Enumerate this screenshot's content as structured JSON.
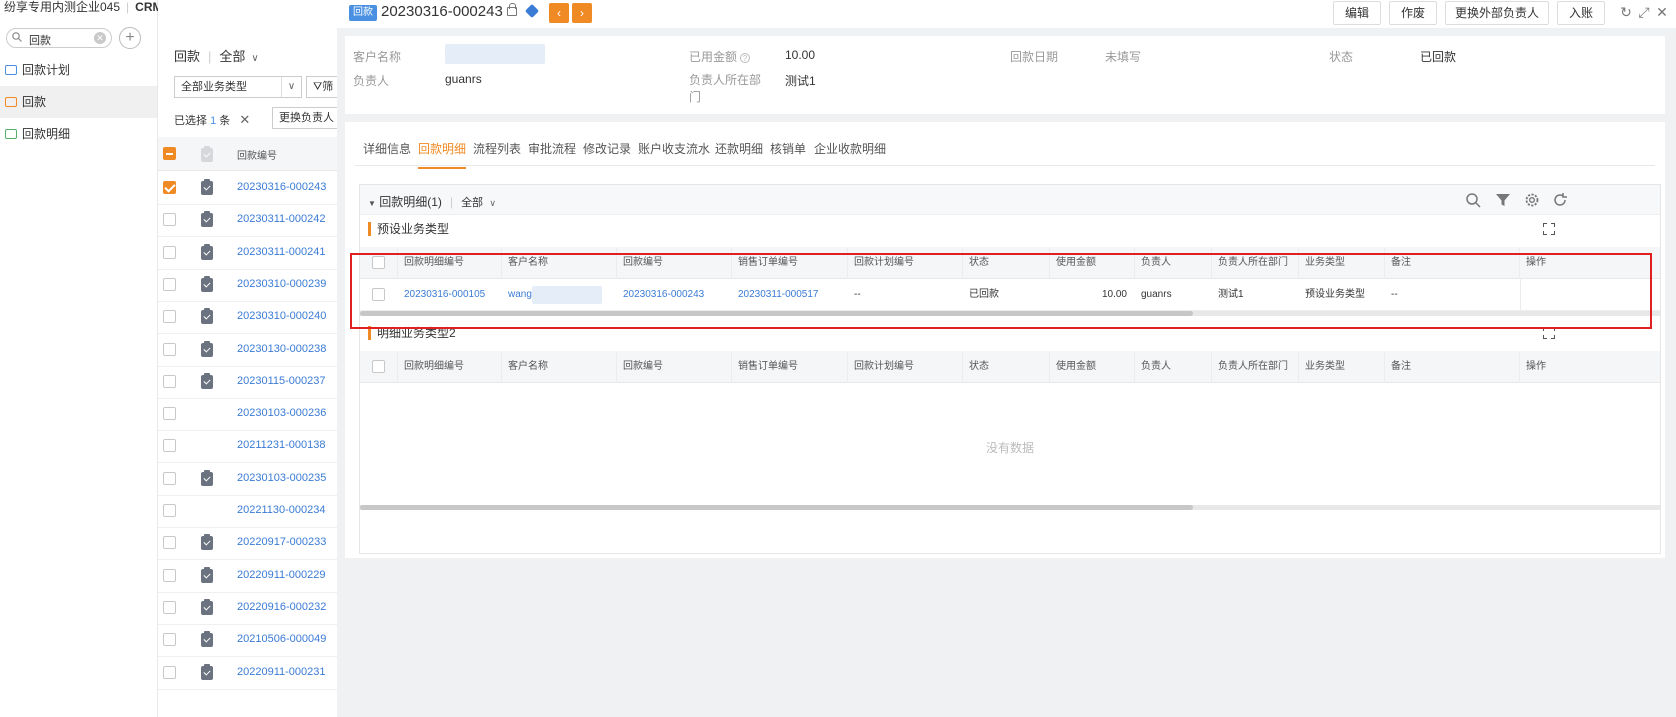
{
  "app": {
    "brand": "纷享专用内测企业045",
    "module": "CRM"
  },
  "nav": {
    "search_value": "回款",
    "items": [
      {
        "label": "回款计划"
      },
      {
        "label": "回款"
      },
      {
        "label": "回款明细"
      }
    ]
  },
  "list": {
    "object": "回款",
    "scope": "全部",
    "type_filter": "全部业务类型",
    "filter_label": "筛",
    "selected_prefix": "已选择",
    "selected_count": "1",
    "selected_suffix": "条",
    "change_owner": "更换负责人",
    "col_code": "回款编号",
    "rows": [
      {
        "code": "20230316-000243",
        "checked": true,
        "icon": true
      },
      {
        "code": "20230311-000242",
        "checked": false,
        "icon": true
      },
      {
        "code": "20230311-000241",
        "checked": false,
        "icon": true
      },
      {
        "code": "20230310-000239",
        "checked": false,
        "icon": true
      },
      {
        "code": "20230310-000240",
        "checked": false,
        "icon": true
      },
      {
        "code": "20230130-000238",
        "checked": false,
        "icon": true
      },
      {
        "code": "20230115-000237",
        "checked": false,
        "icon": true
      },
      {
        "code": "20230103-000236",
        "checked": false,
        "icon": false
      },
      {
        "code": "20211231-000138",
        "checked": false,
        "icon": false
      },
      {
        "code": "20230103-000235",
        "checked": false,
        "icon": true
      },
      {
        "code": "20221130-000234",
        "checked": false,
        "icon": false
      },
      {
        "code": "20220917-000233",
        "checked": false,
        "icon": true
      },
      {
        "code": "20220911-000229",
        "checked": false,
        "icon": true
      },
      {
        "code": "20220916-000232",
        "checked": false,
        "icon": true
      },
      {
        "code": "20210506-000049",
        "checked": false,
        "icon": true
      },
      {
        "code": "20220911-000231",
        "checked": false,
        "icon": true
      }
    ]
  },
  "detail": {
    "badge": "回款",
    "title": "20230316-000243",
    "actions": {
      "edit": "编辑",
      "void": "作废",
      "change_ext_owner": "更换外部负责人",
      "post": "入账"
    },
    "fields": {
      "customer_label": "客户名称",
      "used_amount_label": "已用金额",
      "used_amount": "10.00",
      "payment_date_label": "回款日期",
      "payment_date": "未填写",
      "status_label": "状态",
      "status": "已回款",
      "owner_label": "负责人",
      "owner": "guanrs",
      "owner_dept_label": "负责人所在部门",
      "owner_dept": "测试1"
    },
    "tabs": [
      "详细信息",
      "回款明细",
      "流程列表",
      "审批流程",
      "修改记录",
      "账户收支流水",
      "还款明细",
      "核销单",
      "企业收款明细"
    ],
    "sub": {
      "title": "回款明细(1)",
      "scope": "全部",
      "section1": "预设业务类型",
      "section2": "明细业务类型2",
      "columns": [
        "回款明细编号",
        "客户名称",
        "回款编号",
        "销售订单编号",
        "回款计划编号",
        "状态",
        "使用金额",
        "负责人",
        "负责人所在部门",
        "业务类型",
        "备注",
        "操作"
      ],
      "row": {
        "detail_code": "20230316-000105",
        "customer": "wang",
        "payment_code": "20230316-000243",
        "order_code": "20230311-000517",
        "plan_code": "--",
        "status": "已回款",
        "amount": "10.00",
        "owner": "guanrs",
        "dept": "测试1",
        "biz_type": "预设业务类型",
        "remark": "--"
      },
      "no_data": "没有数据"
    }
  },
  "colors": {
    "accent": "#f08a24",
    "link": "#3a7bd5",
    "highlight": "#e02020"
  }
}
